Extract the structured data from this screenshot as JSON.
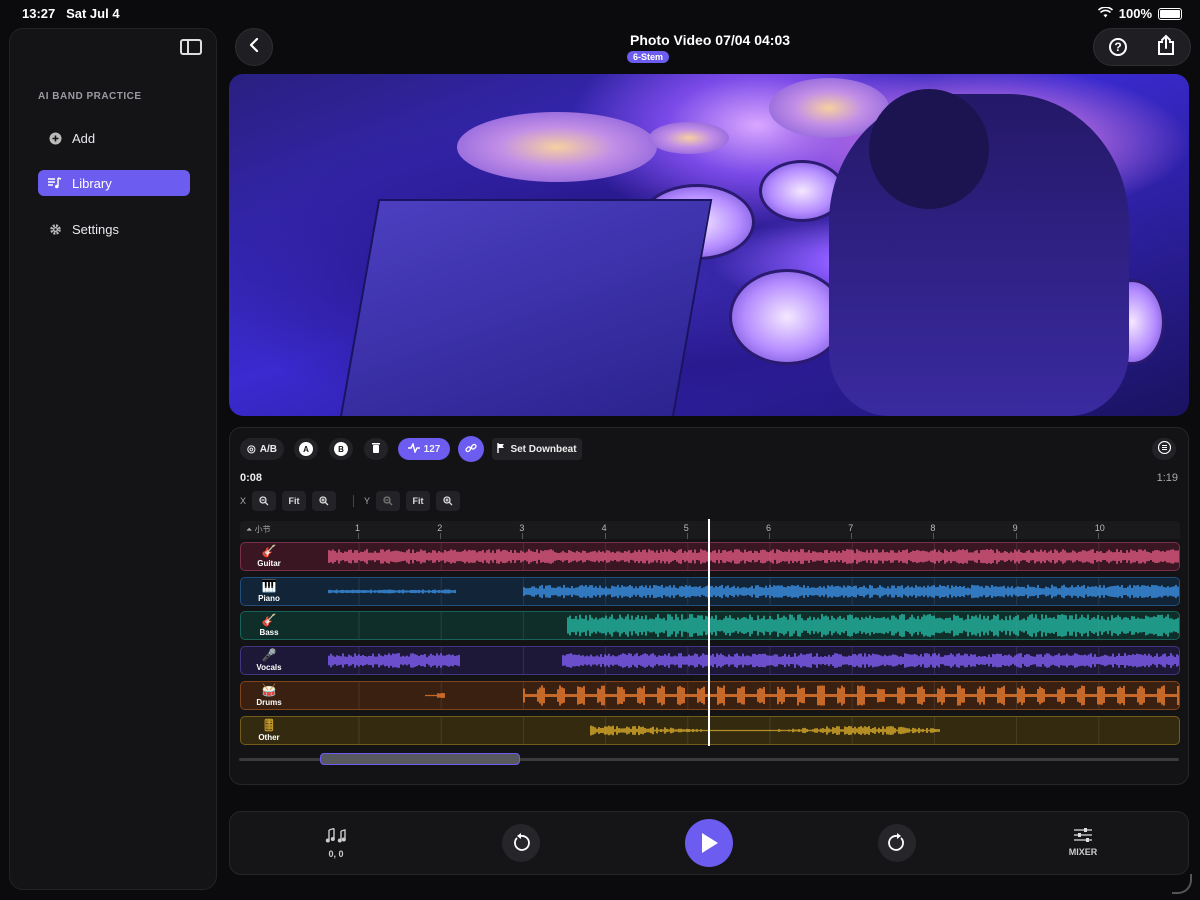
{
  "status_bar": {
    "time": "13:27",
    "date": "Sat Jul 4",
    "battery": "100%"
  },
  "sidebar": {
    "heading": "AI BAND PRACTICE",
    "items": [
      {
        "label": "Add",
        "icon": "plus-circle-icon",
        "active": false
      },
      {
        "label": "Library",
        "icon": "music-list-icon",
        "active": true
      },
      {
        "label": "Settings",
        "icon": "gear-icon",
        "active": false
      }
    ]
  },
  "header": {
    "title": "Photo Video 07/04 04:03",
    "badge": "6-Stem"
  },
  "toolbar": {
    "ab_label": "A/B",
    "a_label": "A",
    "b_label": "B",
    "bpm": "127",
    "downbeat_label": "Set Downbeat"
  },
  "timeline": {
    "current_time": "0:08",
    "duration": "1:19",
    "x_axis_label": "X",
    "y_axis_label": "Y",
    "fit_label": "Fit",
    "ruler_label": "小节",
    "bars": [
      "1",
      "2",
      "3",
      "4",
      "5",
      "6",
      "7",
      "8",
      "9",
      "10"
    ],
    "tracks": [
      {
        "name": "Guitar",
        "icon": "🎸",
        "color": "#d9577f",
        "bg": "#3a1622"
      },
      {
        "name": "Piano",
        "icon": "🎹",
        "color": "#3a8ee0",
        "bg": "#112438"
      },
      {
        "name": "Bass",
        "icon": "🎸",
        "color": "#24b3a0",
        "bg": "#0f2e2a"
      },
      {
        "name": "Vocals",
        "icon": "🎤",
        "color": "#7d5cf0",
        "bg": "#1e1838"
      },
      {
        "name": "Drums",
        "icon": "🥁",
        "color": "#e97a2e",
        "bg": "#3a2010"
      },
      {
        "name": "Other",
        "icon": "🎚",
        "color": "#d6a72a",
        "bg": "#332a10"
      }
    ]
  },
  "transport": {
    "notes_value": "0, 0",
    "mixer_label": "MIXER"
  },
  "colors": {
    "accent": "#6c5cf0"
  }
}
